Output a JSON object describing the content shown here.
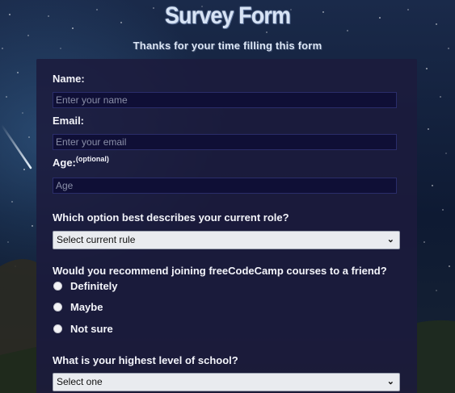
{
  "page": {
    "title": "Survey Form",
    "subtitle": "Thanks for your time filling this form"
  },
  "form": {
    "name": {
      "label": "Name:",
      "placeholder": "Enter your name"
    },
    "email": {
      "label": "Email:",
      "placeholder": "Enter your email"
    },
    "age": {
      "label": "Age:",
      "optional_note": "(optional)",
      "placeholder": "Age"
    },
    "role": {
      "question": "Which option best describes your current role?",
      "selected": "Select current rule"
    },
    "recommend": {
      "question": "Would you recommend joining freeCodeCamp courses to a friend?",
      "options": [
        "Definitely",
        "Maybe",
        "Not sure"
      ]
    },
    "school": {
      "question": "What is your highest level of school?",
      "selected": "Select one"
    }
  },
  "icons": {
    "dropdown": "chevron-down-icon",
    "radio": "radio-button-icon"
  },
  "colors": {
    "panel": "#1c1b3c",
    "input_bg": "#0f0f36",
    "select_bg": "#e9ebef",
    "text": "#f3f4fa"
  }
}
